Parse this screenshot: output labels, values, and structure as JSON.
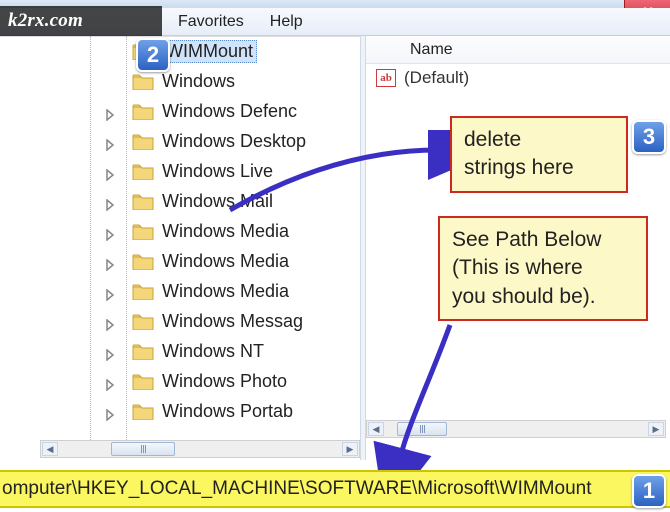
{
  "watermark": "k2rx.com",
  "menus": {
    "favorites": "Favorites",
    "help": "Help"
  },
  "closebtn": "X",
  "tree": {
    "items": [
      {
        "label": "WIMMount",
        "selected": true,
        "expandable": false
      },
      {
        "label": "Windows",
        "expandable": false
      },
      {
        "label": "Windows Defenc",
        "expandable": true
      },
      {
        "label": "Windows Desktop",
        "expandable": true
      },
      {
        "label": "Windows Live",
        "expandable": true
      },
      {
        "label": "Windows Mail",
        "expandable": true
      },
      {
        "label": "Windows Media",
        "expandable": true
      },
      {
        "label": "Windows Media",
        "expandable": true
      },
      {
        "label": "Windows Media",
        "expandable": true
      },
      {
        "label": "Windows Messag",
        "expandable": true
      },
      {
        "label": "Windows NT",
        "expandable": true
      },
      {
        "label": "Windows Photo",
        "expandable": true
      },
      {
        "label": "Windows Portab",
        "expandable": true
      }
    ]
  },
  "values": {
    "header": "Name",
    "rows": [
      {
        "icon": "ab",
        "name": "(Default)"
      }
    ]
  },
  "status_path": "omputer\\HKEY_LOCAL_MACHINE\\SOFTWARE\\Microsoft\\WIMMount",
  "annotations": {
    "b2": "2",
    "b3": "3",
    "b1": "1",
    "callout_delete_l1": "delete",
    "callout_delete_l2": "strings here",
    "callout_path_l1": "See Path Below",
    "callout_path_l2": "(This is where",
    "callout_path_l3": "you should be)."
  }
}
